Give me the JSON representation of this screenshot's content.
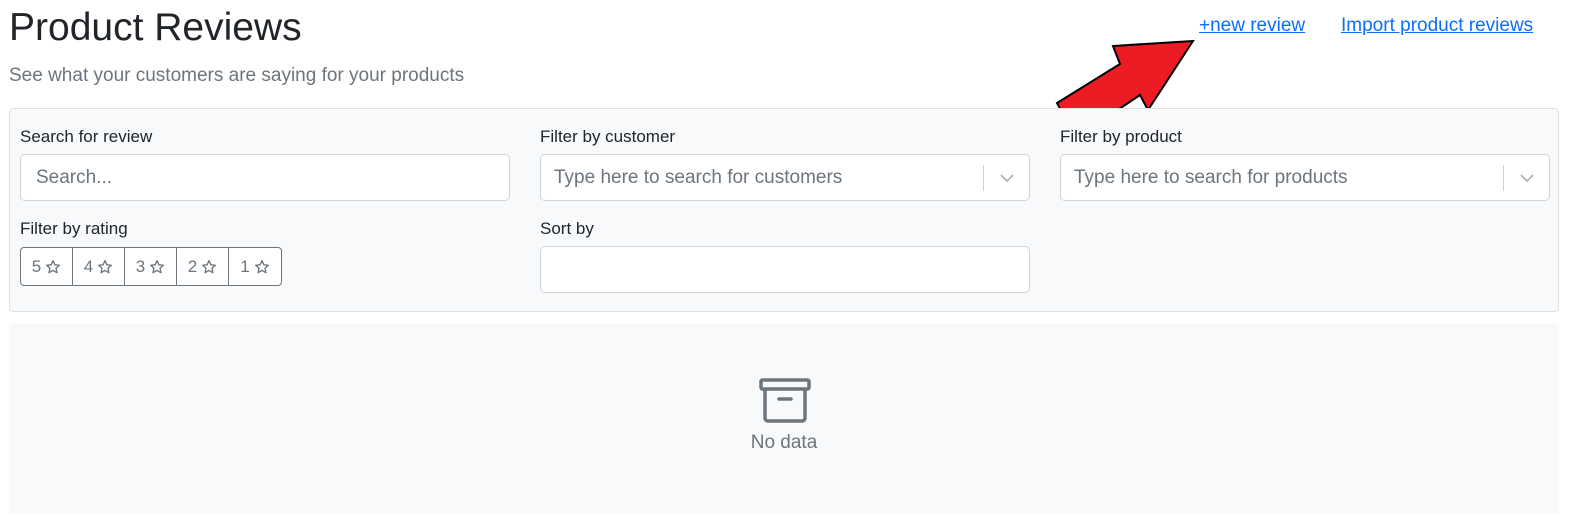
{
  "header": {
    "title": "Product Reviews",
    "subtitle": "See what your customers are saying for your products",
    "new_review_link": "+new review",
    "import_link": "Import product reviews"
  },
  "filters": {
    "search": {
      "label": "Search for review",
      "placeholder": "Search..."
    },
    "customer": {
      "label": "Filter by customer",
      "placeholder": "Type here to search for customers"
    },
    "product": {
      "label": "Filter by product",
      "placeholder": "Type here to search for products"
    },
    "rating": {
      "label": "Filter by rating",
      "options": [
        "5",
        "4",
        "3",
        "2",
        "1"
      ]
    },
    "sort": {
      "label": "Sort by",
      "value": ""
    }
  },
  "empty_state": {
    "text": "No data"
  },
  "colors": {
    "link": "#0d6efd",
    "muted": "#6c757d",
    "panel": "#f8f9fa",
    "arrow": "#ed1c24"
  }
}
